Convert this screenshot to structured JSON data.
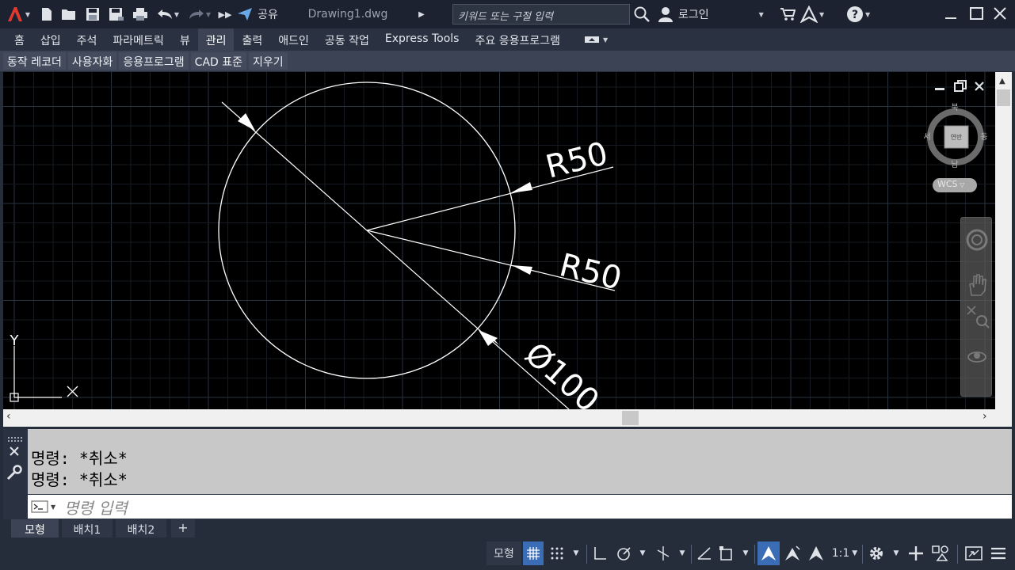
{
  "titlebar": {
    "share_label": "공유",
    "file_name": "Drawing1.dwg",
    "search_placeholder": "키워드 또는 구절 입력",
    "login_label": "로그인"
  },
  "ribbon": {
    "tabs": [
      "홈",
      "삽입",
      "주석",
      "파라메트릭",
      "뷰",
      "관리",
      "출력",
      "애드인",
      "공동 작업",
      "Express Tools",
      "주요 응용프로그램"
    ],
    "active_tab": "관리",
    "panels": [
      "동작 레코더",
      "사용자화",
      "응용프로그램",
      "CAD 표준",
      "지우기"
    ]
  },
  "viewcube": {
    "north": "북",
    "south": "남",
    "west": "서",
    "east": "동",
    "face": "연반",
    "wcs": "WCS"
  },
  "drawing": {
    "dim_radius_1": "R50",
    "dim_radius_2": "R50",
    "dim_diameter": "Ø100",
    "ucs_y": "Y"
  },
  "command": {
    "history": [
      "명령: *취소*",
      "명령: *취소*"
    ],
    "placeholder": "명령 입력"
  },
  "layout_tabs": [
    "모형",
    "배치1",
    "배치2"
  ],
  "statusbar": {
    "model_label": "모형",
    "scale_label": "1:1"
  }
}
